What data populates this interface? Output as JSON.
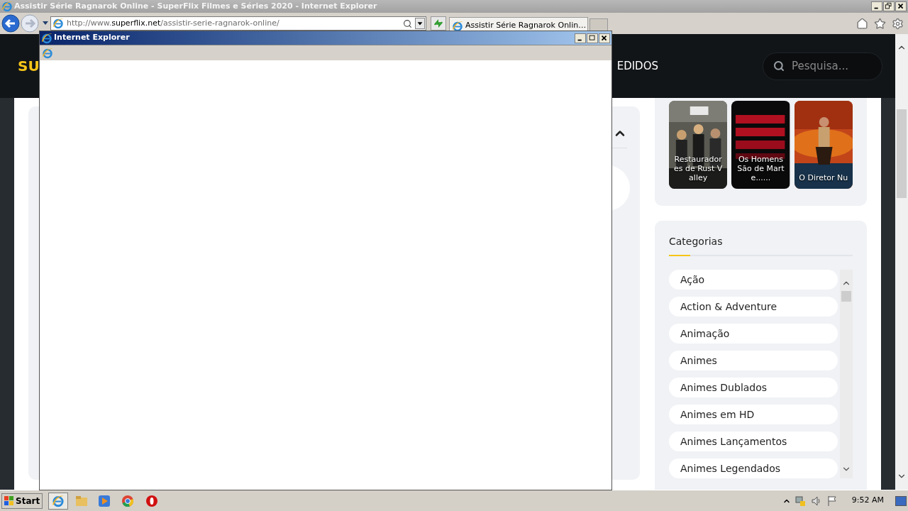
{
  "window": {
    "title": "Assistir Série Ragnarok Online - SuperFlix Filmes e Séries 2020 - Internet Explorer"
  },
  "address_bar": {
    "prefix": "http://www.",
    "domain": "superflix.net",
    "path": "/assistir-serie-ragnarok-online/"
  },
  "tabs": [
    {
      "label": "Assistir Série Ragnarok Onlin…",
      "selected": true
    }
  ],
  "site": {
    "logo": "SU",
    "nav_item": "EDIDOS",
    "search": {
      "placeholder": "Pesquisa..."
    },
    "posters": [
      {
        "title": "Restauradores de Rust Valley",
        "kind": "picture"
      },
      {
        "title": "Os Homens São de Marte......",
        "kind": "picture"
      },
      {
        "title": "O Diretor Nu",
        "kind": "picture"
      }
    ],
    "categories": {
      "title": "Categorias",
      "items": [
        "Ação",
        "Action & Adventure",
        "Animação",
        "Animes",
        "Animes Dublados",
        "Animes em HD",
        "Animes Lançamentos",
        "Animes Legendados"
      ]
    }
  },
  "popup": {
    "title": "Internet Explorer"
  },
  "taskbar": {
    "start": "Start",
    "clock": "9:52 AM"
  }
}
